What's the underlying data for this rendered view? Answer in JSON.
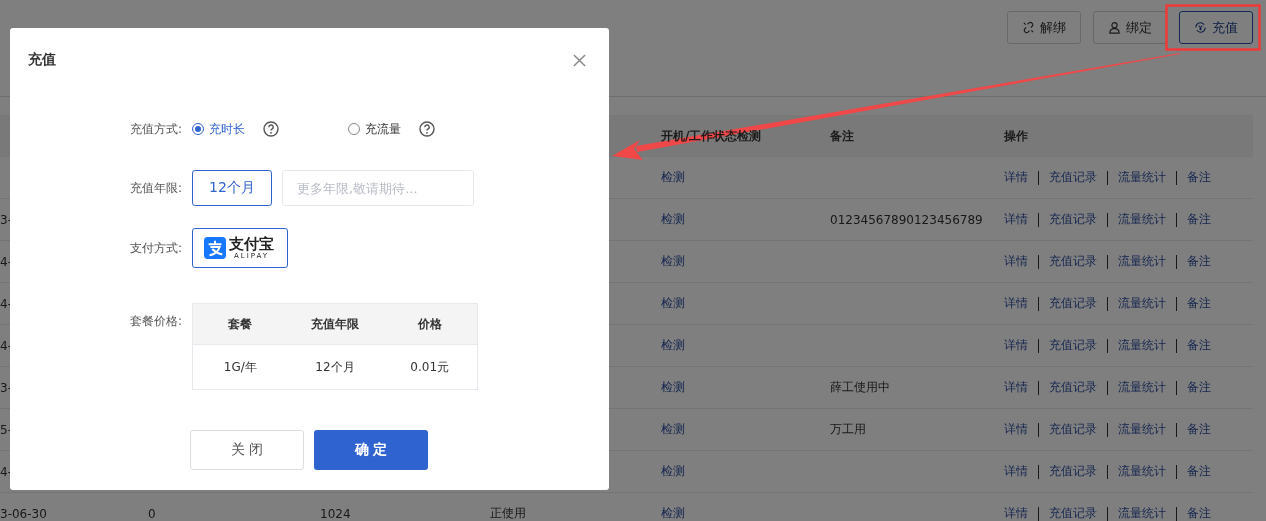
{
  "toolbar": {
    "buttons": [
      {
        "label": "解绑",
        "kind": "unlink",
        "highlighted": false
      },
      {
        "label": "绑定",
        "kind": "user",
        "highlighted": false
      },
      {
        "label": "充值",
        "kind": "recharge",
        "highlighted": true
      }
    ]
  },
  "table": {
    "columns": [
      "开机/工作状态检测",
      "备注",
      "操作"
    ],
    "rows": [
      {
        "check": "检测",
        "actions": [
          "详情",
          "充值记录",
          "流量统计",
          "备注"
        ]
      },
      {
        "column_1": "3-",
        "check": "检测",
        "remark": "01234567890123456789",
        "actions": [
          "详情",
          "充值记录",
          "流量统计",
          "备注"
        ]
      },
      {
        "column_1": "4-",
        "check": "检测",
        "actions": [
          "详情",
          "充值记录",
          "流量统计",
          "备注"
        ]
      },
      {
        "column_1": "4-",
        "check": "检测",
        "actions": [
          "详情",
          "充值记录",
          "流量统计",
          "备注"
        ]
      },
      {
        "column_1": "4-",
        "check": "检测",
        "actions": [
          "详情",
          "充值记录",
          "流量统计",
          "备注"
        ]
      },
      {
        "column_1": "3-",
        "check": "检测",
        "remark": "薛工使用中",
        "actions": [
          "详情",
          "充值记录",
          "流量统计",
          "备注"
        ]
      },
      {
        "column_1": "5-",
        "check": "检测",
        "remark": "万工用",
        "actions": [
          "详情",
          "充值记录",
          "流量统计",
          "备注"
        ]
      },
      {
        "column_1": "4-",
        "check": "检测",
        "actions": [
          "详情",
          "充值记录",
          "流量统计",
          "备注"
        ]
      },
      {
        "column_1": "3-06-30",
        "column_2": "0",
        "column_3": "1024",
        "column_4": "正使用",
        "check": "检测",
        "actions": [
          "详情",
          "充值记录",
          "流量统计",
          "备注"
        ]
      }
    ]
  },
  "dialog": {
    "title": "充值",
    "recharge_mode": {
      "label": "充值方式:",
      "options": [
        {
          "label": "充时长",
          "selected": true
        },
        {
          "label": "充流量",
          "selected": false
        }
      ]
    },
    "duration": {
      "label": "充值年限:",
      "options": [
        {
          "label": "12个月",
          "selected": true
        }
      ],
      "more": {
        "placeholder": "更多年限,敬请期待..."
      }
    },
    "payment": {
      "label": "支付方式:",
      "options": [
        {
          "name": "支付宝",
          "subtitle": "ALIPAY",
          "selected": true
        }
      ]
    },
    "plans": {
      "label": "套餐价格:",
      "columns": [
        "套餐",
        "充值年限",
        "价格"
      ],
      "rows": [
        [
          "1G/年",
          "12个月",
          "0.01元"
        ]
      ]
    },
    "buttons": [
      {
        "label": "关 闭",
        "kind": "secondary"
      },
      {
        "label": "确 定",
        "kind": "primary"
      }
    ]
  }
}
